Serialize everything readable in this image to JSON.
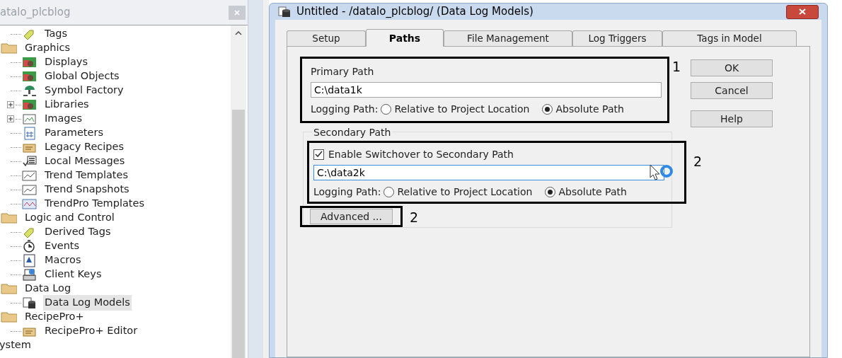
{
  "left_panel": {
    "title": "atalo_plcblog",
    "tree": [
      {
        "children": [
          {
            "children": [
              {
                "label": "Tags",
                "kind": "tag",
                "selected": false
              }
            ]
          },
          {
            "label": "Graphics",
            "kind": "folder",
            "selected": false,
            "children": [
              {
                "label": "Displays",
                "kind": "display",
                "selected": false
              },
              {
                "label": "Global Objects",
                "kind": "display",
                "selected": false
              },
              {
                "label": "Symbol Factory",
                "kind": "symbol",
                "selected": false
              },
              {
                "label": "Libraries",
                "kind": "display",
                "selected": false,
                "expanded": false
              },
              {
                "label": "Images",
                "kind": "image",
                "selected": false,
                "expanded": false
              },
              {
                "label": "Parameters",
                "kind": "parameters",
                "selected": false
              },
              {
                "label": "Legacy Recipes",
                "kind": "recipe",
                "selected": false
              },
              {
                "label": "Local Messages",
                "kind": "messages",
                "selected": false
              },
              {
                "label": "Trend Templates",
                "kind": "trend",
                "selected": false
              },
              {
                "label": "Trend Snapshots",
                "kind": "trend",
                "selected": false
              },
              {
                "label": "TrendPro Templates",
                "kind": "trendpro",
                "selected": false
              }
            ]
          },
          {
            "label": "Logic and Control",
            "kind": "folder",
            "selected": false,
            "children": [
              {
                "label": "Derived Tags",
                "kind": "tag",
                "selected": false
              },
              {
                "label": "Events",
                "kind": "clock",
                "selected": false
              },
              {
                "label": "Macros",
                "kind": "macro",
                "selected": false
              },
              {
                "label": "Client Keys",
                "kind": "keys",
                "selected": false
              }
            ]
          },
          {
            "label": "Data Log",
            "kind": "folder",
            "selected": false,
            "children": [
              {
                "label": "Data Log Models",
                "kind": "datalog",
                "selected": true
              }
            ]
          },
          {
            "label": "RecipePro+",
            "kind": "folder",
            "selected": false,
            "children": [
              {
                "label": "RecipePro+ Editor",
                "kind": "recipe",
                "selected": false
              }
            ]
          }
        ]
      },
      {
        "label": "ystem",
        "selected": false
      }
    ]
  },
  "dialog": {
    "title": "Untitled - /datalo_plcblog/ (Data Log Models)",
    "tabs": [
      {
        "label": "Setup",
        "selected": false
      },
      {
        "label": "Paths",
        "selected": true
      },
      {
        "label": "File Management",
        "selected": false
      },
      {
        "label": "Log Triggers",
        "selected": false
      },
      {
        "label": "Tags in Model",
        "selected": false
      }
    ],
    "primary_path": {
      "label": "Primary Path",
      "value": "C:\\data1k",
      "logging_path_label": "Logging Path:",
      "options": [
        {
          "label": "Relative to Project Location",
          "selected": false
        },
        {
          "label": "Absolute Path",
          "selected": true
        }
      ]
    },
    "secondary_path": {
      "label": "Secondary Path",
      "switchover": {
        "label": "Enable Switchover to Secondary Path",
        "checked": true
      },
      "value": "C:\\data2k",
      "logging_path_label": "Logging Path:",
      "options": [
        {
          "label": "Relative to Project Location",
          "selected": false
        },
        {
          "label": "Absolute Path",
          "selected": true
        }
      ]
    },
    "advanced_button": "Advanced ...",
    "buttons": [
      "OK",
      "Cancel",
      "Help"
    ]
  },
  "annotations": [
    "1",
    "2",
    "2"
  ]
}
